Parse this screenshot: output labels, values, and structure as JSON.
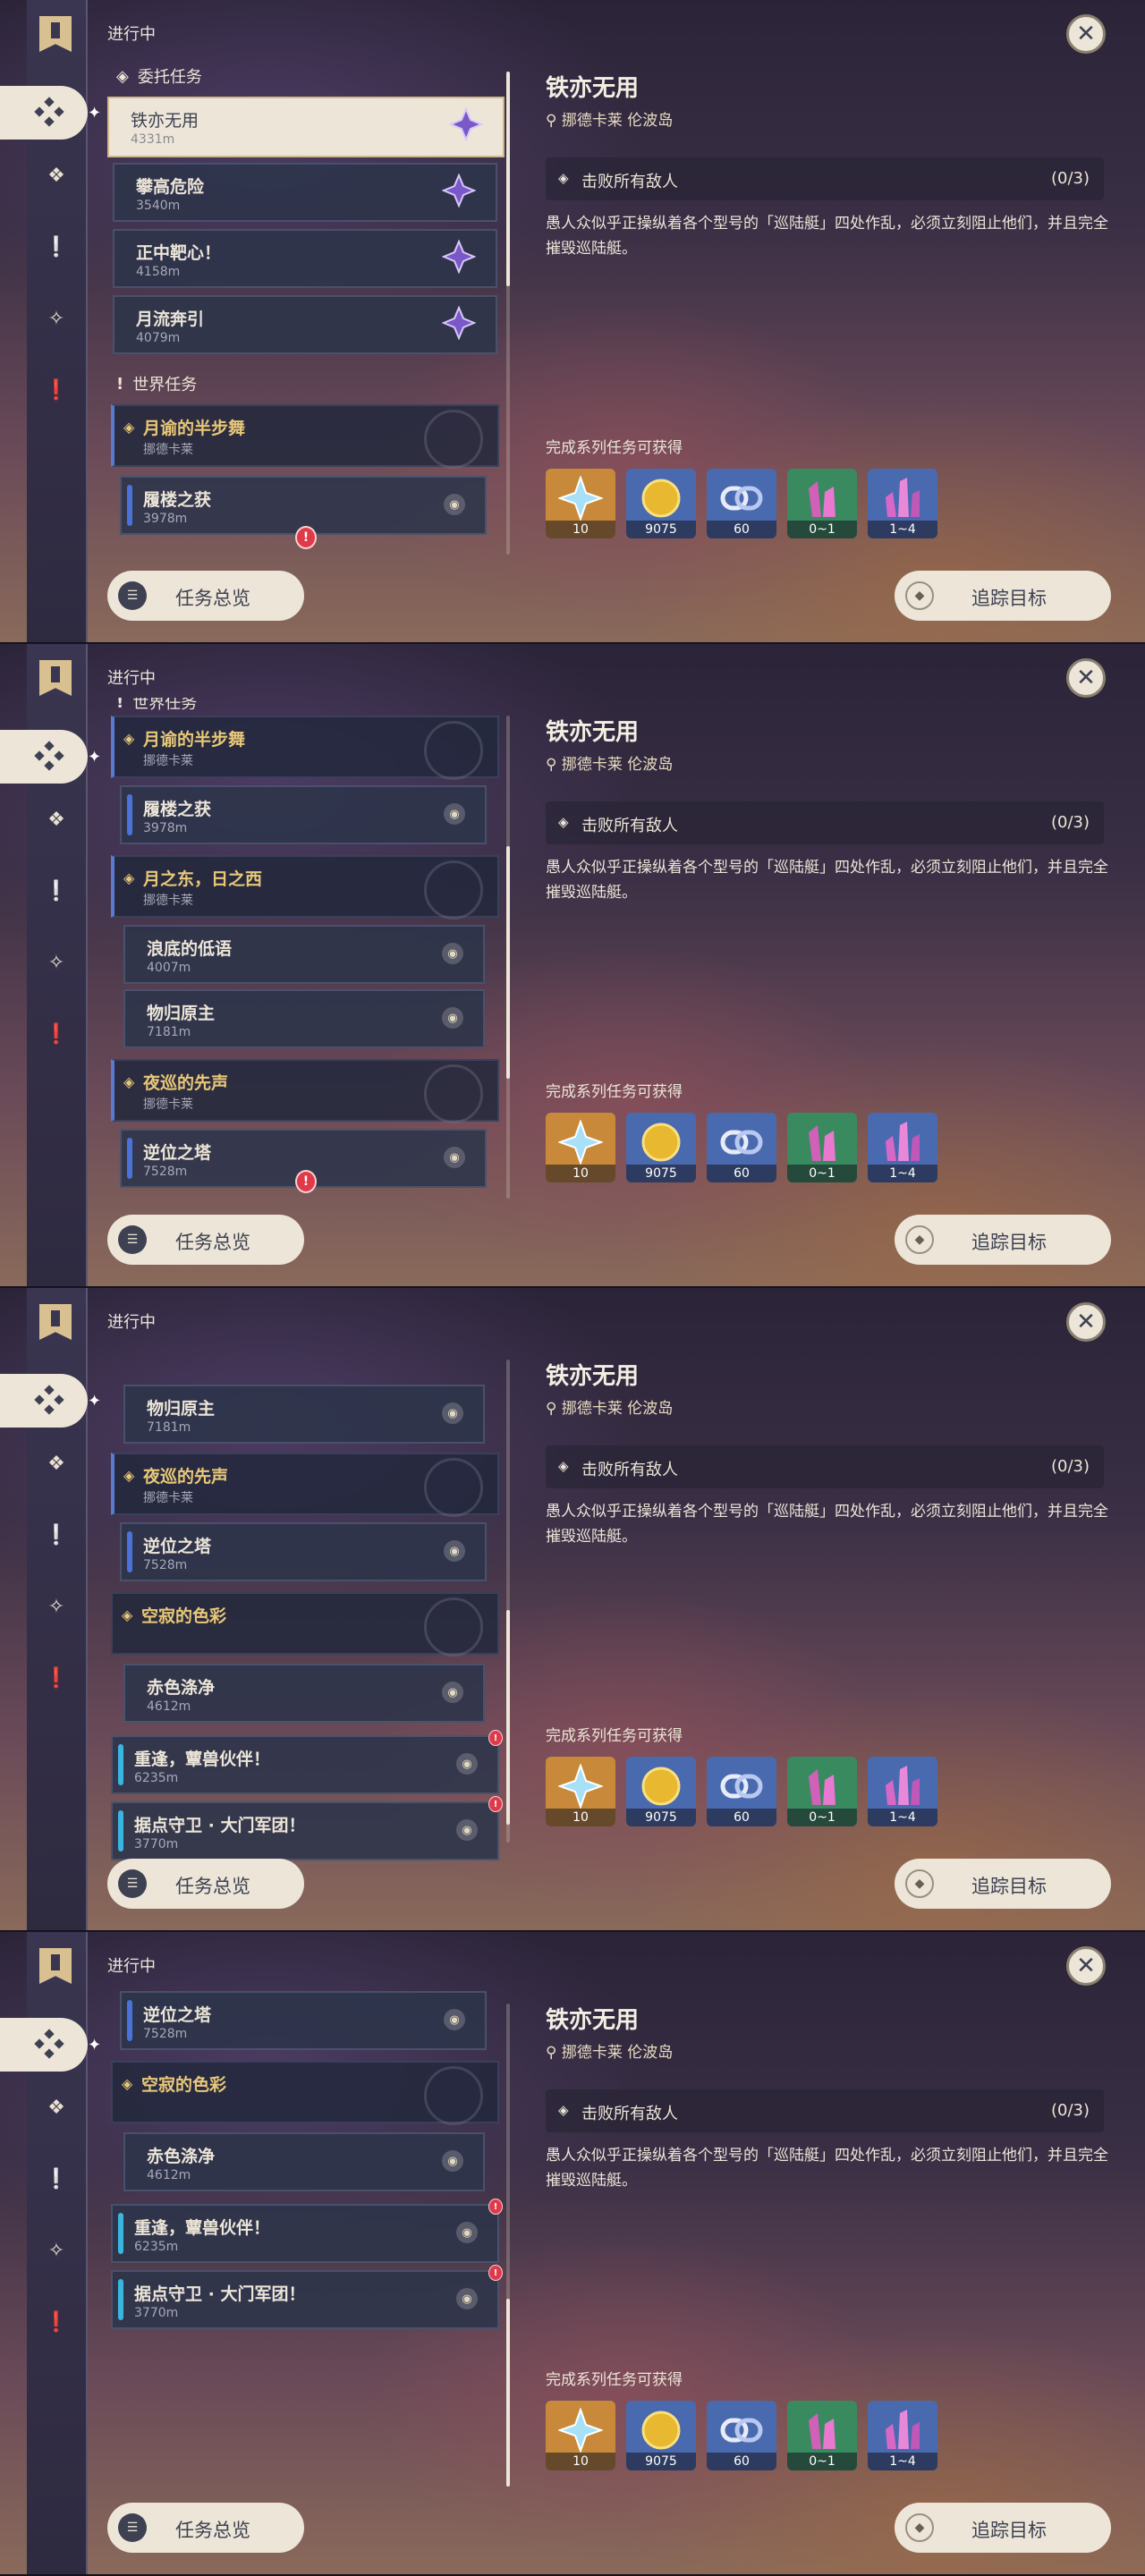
{
  "header_label": "进行中",
  "categories": {
    "commission": "委托任务",
    "world": "世界任务"
  },
  "quests": {
    "tieyiwuyong": {
      "name": "铁亦无用",
      "dist": "4331m"
    },
    "pangaoweixian": {
      "name": "攀高危险",
      "dist": "3540m"
    },
    "zhengzhongbaxin": {
      "name": "正中靶心！",
      "dist": "4158m"
    },
    "yueliubenyin": {
      "name": "月流奔引",
      "dist": "4079m"
    },
    "yueyubanbuwu": {
      "name": "月谕的半步舞",
      "region": "挪德卡莱"
    },
    "lvlouzhihuo": {
      "name": "履楼之获",
      "dist": "3978m"
    },
    "yuezhidong": {
      "name": "月之东，日之西",
      "region": "挪德卡莱"
    },
    "langdideidiyu": {
      "name": "浪底的低语",
      "dist": "4007m"
    },
    "wuguiyuanzhu": {
      "name": "物归原主",
      "dist": "7181m"
    },
    "yexundexiansheng": {
      "name": "夜巡的先声",
      "region": "挪德卡莱"
    },
    "niweizhita": {
      "name": "逆位之塔",
      "dist": "7528m"
    },
    "kongjidesecai": {
      "name": "空寂的色彩"
    },
    "chisedijing": {
      "name": "赤色涤净",
      "dist": "4612m"
    },
    "chongfeng": {
      "name": "重逢，蕈兽伙伴！",
      "dist": "6235m"
    },
    "judianshouwei": {
      "name": "据点守卫 · 大门军团！",
      "dist": "3770m"
    }
  },
  "detail": {
    "title": "铁亦无用",
    "location": "挪德卡莱 伦波岛",
    "objective": "击败所有敌人",
    "progress": "(0/3)",
    "description": "愚人众似乎正操纵着各个型号的「巡陆艇」四处作乱，必须立刻阻止他们，并且完全摧毁巡陆艇。",
    "rewards_label": "完成系列任务可获得",
    "rewards": [
      {
        "name": "primogem",
        "count": "10",
        "color": "#c88a3a"
      },
      {
        "name": "mora",
        "count": "9075",
        "color": "#4a6ab0"
      },
      {
        "name": "adventure-exp",
        "count": "60",
        "color": "#4a6ab0"
      },
      {
        "name": "crystal-green",
        "count": "0~1",
        "color": "#3a8a60"
      },
      {
        "name": "crystal-blue",
        "count": "1~4",
        "color": "#4a6ab0"
      }
    ]
  },
  "buttons": {
    "overview": "任务总览",
    "track": "追踪目标"
  },
  "colors": {
    "cream": "#ece5d8",
    "dark_text": "#3d4151",
    "gold": "#e8c878",
    "blue_bar": "#4a72d8",
    "cyan_bar": "#38b6e0",
    "alert": "#e03a4a"
  }
}
